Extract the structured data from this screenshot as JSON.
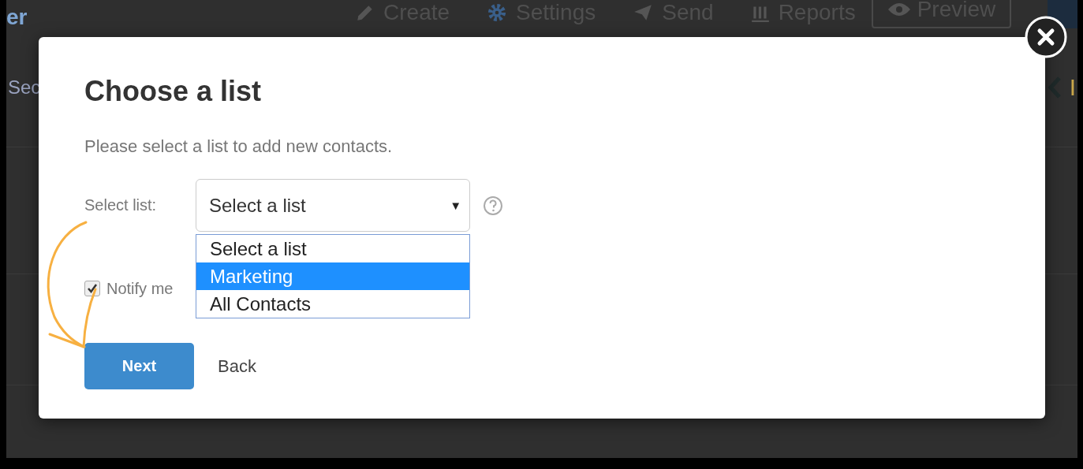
{
  "background_page": {
    "logo_text": "er",
    "nav": [
      {
        "label": "Create",
        "kind": "pencil"
      },
      {
        "label": "Settings",
        "kind": "gear"
      },
      {
        "label": "Send",
        "kind": "plane"
      },
      {
        "label": "Reports",
        "kind": "chart"
      }
    ],
    "preview_button": "Preview",
    "left_text": "Sec",
    "right_text": "I"
  },
  "dialog": {
    "title": "Choose a list",
    "description": "Please select a list to add new contacts.",
    "select_label": "Select list:",
    "select_value": "Select a list",
    "select_caret": "▼",
    "options": [
      {
        "label": "Select a list",
        "selected": false
      },
      {
        "label": "Marketing",
        "selected": true
      },
      {
        "label": "All Contacts",
        "selected": false
      }
    ],
    "notify": {
      "label": "Notify me",
      "checked": true
    },
    "buttons": [
      {
        "label": "Next",
        "kind": "primary"
      },
      {
        "label": "Back",
        "kind": "link"
      }
    ]
  }
}
